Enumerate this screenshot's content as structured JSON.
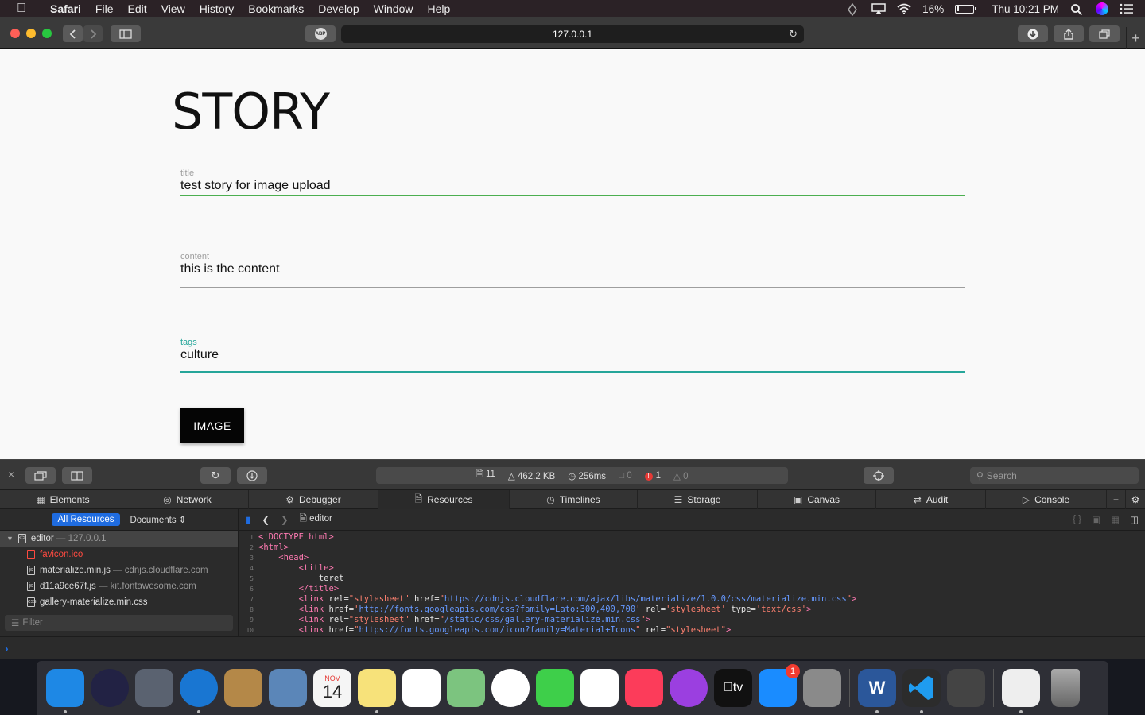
{
  "menubar": {
    "apple_icon": "apple-icon",
    "app_name": "Safari",
    "menus": [
      "File",
      "Edit",
      "View",
      "History",
      "Bookmarks",
      "Develop",
      "Window",
      "Help"
    ],
    "battery_percent": "16%",
    "battery_level": 0.16,
    "clock": "Thu 10:21 PM"
  },
  "browser": {
    "url": "127.0.0.1",
    "adblock_label": "ABP"
  },
  "page": {
    "heading": "STORY",
    "fields": {
      "title_label": "title",
      "title_value": "test story for image upload",
      "content_label": "content",
      "content_value": "this is the content",
      "tags_label": "tags",
      "tags_value": "culture"
    },
    "image_button": "IMAGE"
  },
  "devtools": {
    "stats": {
      "resources": "11",
      "size": "462.2 KB",
      "time": "256ms",
      "logs": "0",
      "errors": "1",
      "warnings": "0"
    },
    "search_placeholder": "Search",
    "tabs": [
      "Elements",
      "Network",
      "Debugger",
      "Resources",
      "Timelines",
      "Storage",
      "Canvas",
      "Audit",
      "Console"
    ],
    "active_tab": "Resources",
    "filter_buttons": {
      "all": "All Resources",
      "documents": "Documents"
    },
    "tree": {
      "root_name": "editor",
      "root_host": "— 127.0.0.1",
      "items": [
        {
          "name": "favicon.ico",
          "host": ""
        },
        {
          "name": "materialize.min.js",
          "host": "— cdnjs.cloudflare.com"
        },
        {
          "name": "d11a9ce67f.js",
          "host": "— kit.fontawesome.com"
        },
        {
          "name": "gallery-materialize.min.css",
          "host": ""
        }
      ]
    },
    "filter_placeholder": "Filter",
    "breadcrumb": "editor",
    "code": {
      "line_numbers": [
        "1",
        "2",
        "3",
        "4",
        "5",
        "6",
        "7",
        "8",
        "9",
        "10"
      ],
      "doctype": "<!DOCTYPE html>",
      "html_open": "<html>",
      "head_open": "<head>",
      "title_open": "<title>",
      "title_text": "teret",
      "title_close": "</title>",
      "link1_href": "https://cdnjs.cloudflare.com/ajax/libs/materialize/1.0.0/css/materialize.min.css",
      "link2_href": "http://fonts.googleapis.com/css?family=Lato:300,400,700",
      "link2_rel": "stylesheet",
      "link2_type": "text/css",
      "link3_href": "/static/css/gallery-materialize.min.css",
      "link3_rel": "stylesheet",
      "link4_href": "https://fonts.googleapis.com/icon?family=Material+Icons",
      "link4_rel": "stylesheet"
    }
  },
  "dock": {
    "apps": [
      {
        "name": "Finder",
        "color": "#1e88e5",
        "running": true
      },
      {
        "name": "Siri",
        "color": "#222244",
        "running": false
      },
      {
        "name": "Launchpad",
        "color": "#5a6270",
        "running": false
      },
      {
        "name": "Safari",
        "color": "#1976d2",
        "running": true
      },
      {
        "name": "Contacts",
        "color": "#b48848",
        "running": false
      },
      {
        "name": "Preview",
        "color": "#5b86b8",
        "running": false
      },
      {
        "name": "Calendar",
        "color": "#f5f5f5",
        "running": false
      },
      {
        "name": "Notes",
        "color": "#f7e27a",
        "running": true
      },
      {
        "name": "Reminders",
        "color": "#ffffff",
        "running": false
      },
      {
        "name": "Maps",
        "color": "#7cc47f",
        "running": false
      },
      {
        "name": "Photos",
        "color": "#ffffff",
        "running": false
      },
      {
        "name": "FaceTime",
        "color": "#3ecf4a",
        "running": false
      },
      {
        "name": "News",
        "color": "#ffffff",
        "running": false
      },
      {
        "name": "Music",
        "color": "#fc3c5a",
        "running": false
      },
      {
        "name": "Podcasts",
        "color": "#9b3fe0",
        "running": false
      },
      {
        "name": "TV",
        "color": "#111111",
        "running": false
      },
      {
        "name": "App Store",
        "color": "#1a8cff",
        "running": false
      },
      {
        "name": "System Preferences",
        "color": "#8a8a8a",
        "running": false
      },
      {
        "name": "Word",
        "color": "#2b579a",
        "running": true
      },
      {
        "name": "VS Code",
        "color": "#2c2c2c",
        "running": true
      },
      {
        "name": "Disk Utility",
        "color": "#444444",
        "running": false
      },
      {
        "name": "Script",
        "color": "#eeeeee",
        "running": true
      },
      {
        "name": "Trash",
        "color": "#777777",
        "running": false
      }
    ],
    "calendar_month": "NOV",
    "calendar_day": "14",
    "tv_label": "tv",
    "appstore_badge": "1",
    "word_letter": "W"
  }
}
